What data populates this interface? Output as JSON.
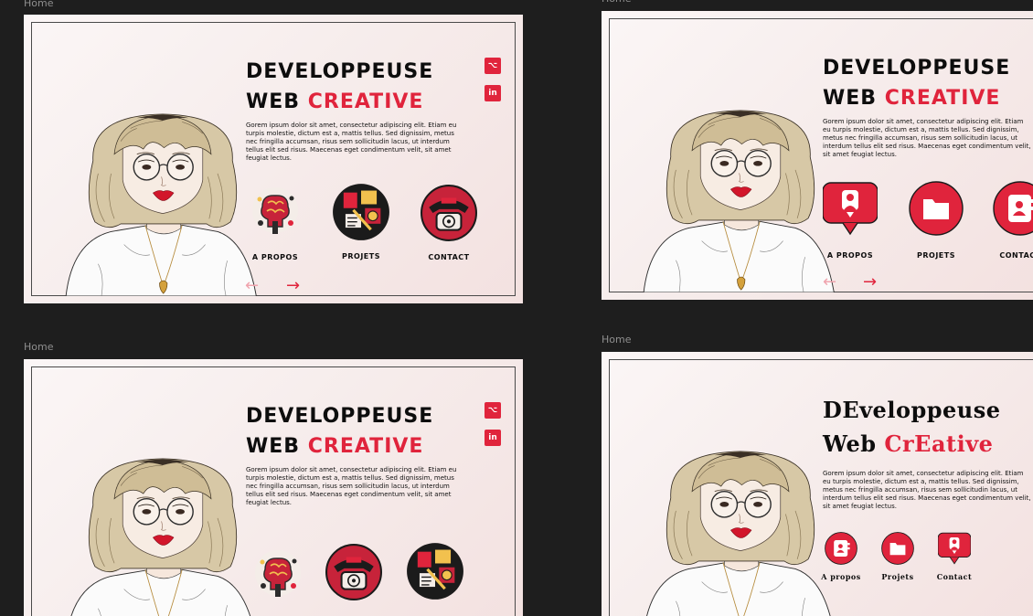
{
  "frame_label": "Home",
  "hero": {
    "title_line1": "DEVELOPPEUSE",
    "title_word2": "WEB",
    "title_accent": "CREATIVE",
    "serif_title_line1": "DEveloppeuse",
    "serif_title_word2": "Web",
    "serif_title_accent": "CrEative",
    "description": "Gorem ipsum dolor sit amet, consectetur adipiscing elit. Etiam eu turpis molestie, dictum est a, mattis tellus. Sed dignissim, metus nec fringilla accumsan, risus sem sollicitudin lacus, ut interdum tellus elit sed risus. Maecenas eget condimentum velit, sit amet feugiat lectus."
  },
  "nav": {
    "about": "A PROPOS",
    "projects": "PROJETS",
    "contact": "CONTACT",
    "about_serif": "A propos",
    "projects_serif": "Projets",
    "contact_serif": "Contact"
  },
  "social": {
    "github": "⌥",
    "linkedin": "in"
  },
  "arrows": {
    "prev": "←",
    "next": "→"
  },
  "colors": {
    "accent": "#e0243c",
    "canvas": "#1e1e1e",
    "ink": "#0d0d0d"
  },
  "icons": [
    "github-icon",
    "linkedin-icon",
    "brain-icon",
    "palette-icon",
    "telephone-icon",
    "chat-bubble-icon",
    "folder-icon",
    "contact-card-icon"
  ]
}
